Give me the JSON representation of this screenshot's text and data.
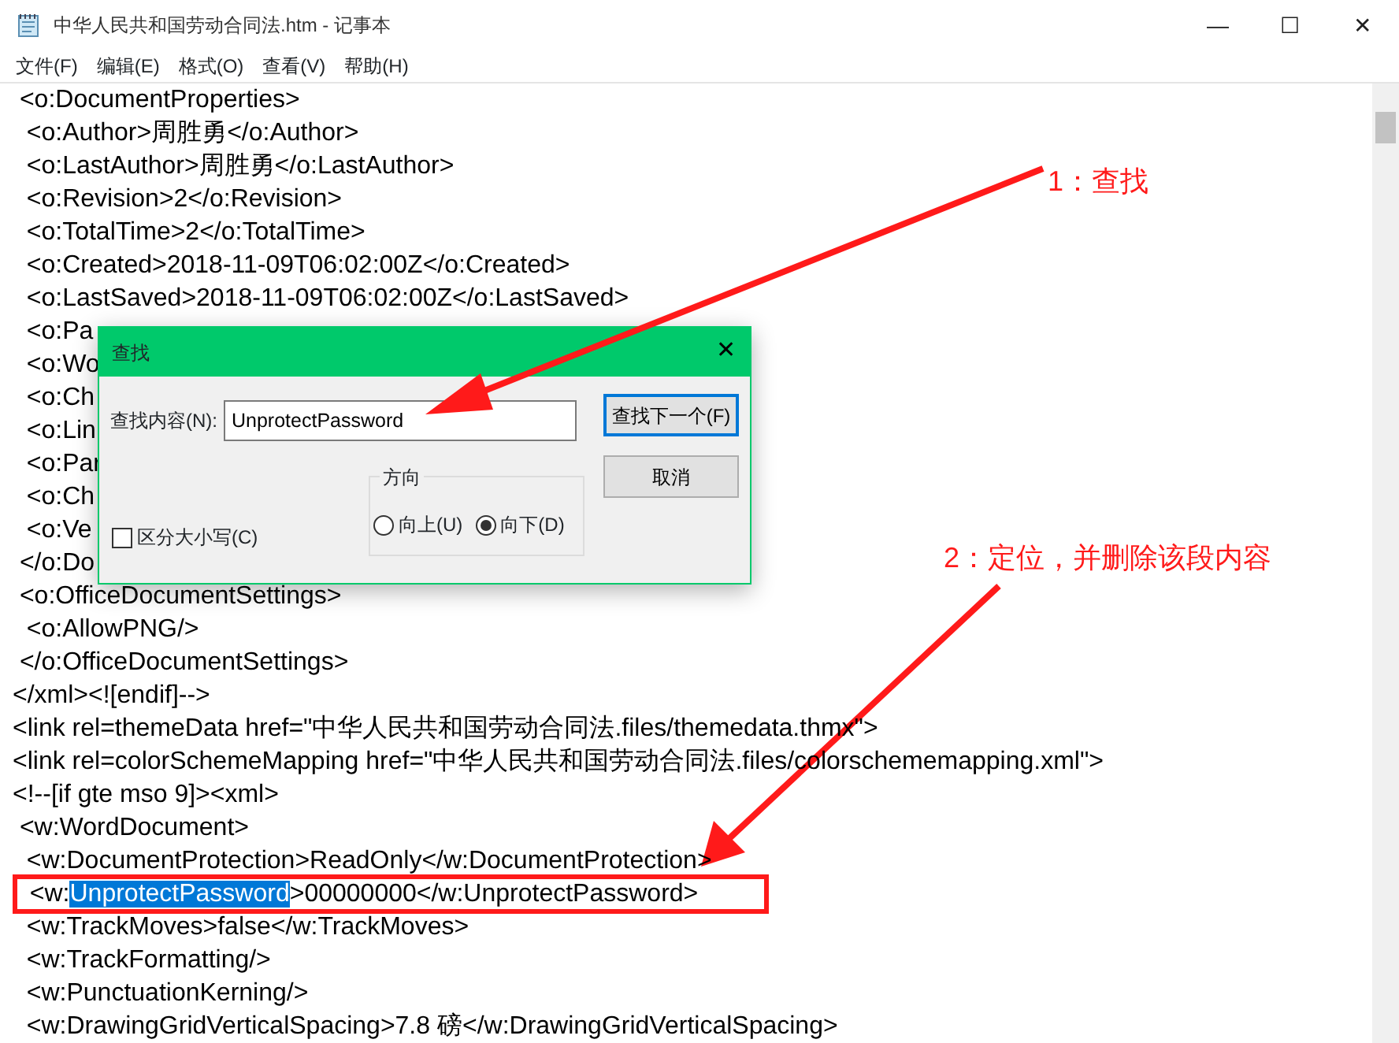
{
  "window": {
    "title": "中华人民共和国劳动合同法.htm - 记事本",
    "controls": [
      "—",
      "☐",
      "✕"
    ]
  },
  "menu": [
    "文件(F)",
    "编辑(E)",
    "格式(O)",
    "查看(V)",
    "帮助(H)"
  ],
  "lines": [
    {
      "text": " <o:DocumentProperties>"
    },
    {
      "text": "  <o:Author>周胜勇</o:Author>"
    },
    {
      "text": "  <o:LastAuthor>周胜勇</o:LastAuthor>"
    },
    {
      "text": "  <o:Revision>2</o:Revision>"
    },
    {
      "text": "  <o:TotalTime>2</o:TotalTime>"
    },
    {
      "text": "  <o:Created>2018-11-09T06:02:00Z</o:Created>"
    },
    {
      "text": "  <o:LastSaved>2018-11-09T06:02:00Z</o:LastSaved>"
    },
    {
      "text": "  <o:Pa"
    },
    {
      "text": "  <o:Wo"
    },
    {
      "text": "  <o:Ch"
    },
    {
      "text": "  <o:Lin"
    },
    {
      "text": "  <o:Par"
    },
    {
      "text": "  <o:Ch"
    },
    {
      "text": "  <o:Ve"
    },
    {
      "text": " </o:Do"
    },
    {
      "text": " <o:OfficeDocumentSettings>"
    },
    {
      "text": "  <o:AllowPNG/>"
    },
    {
      "text": " </o:OfficeDocumentSettings>"
    },
    {
      "text": "</xml><![endif]-->"
    },
    {
      "text": "<link rel=themeData href=\"中华人民共和国劳动合同法.files/themedata.thmx\">"
    },
    {
      "text": "<link rel=colorSchemeMapping href=\"中华人民共和国劳动合同法.files/colorschememapping.xml\">"
    },
    {
      "text": "<!--[if gte mso 9]><xml>"
    },
    {
      "text": " <w:WordDocument>"
    },
    {
      "text": "  <w:DocumentProtection>ReadOnly</w:DocumentProtection>"
    },
    {
      "boxed": true,
      "parts": [
        {
          "text": "  <w:",
          "selected": false
        },
        {
          "text": "UnprotectPassword",
          "selected": true
        },
        {
          "text": ">00000000</w:UnprotectPassword>",
          "selected": false
        }
      ]
    },
    {
      "text": "  <w:TrackMoves>false</w:TrackMoves>"
    },
    {
      "text": "  <w:TrackFormatting/>"
    },
    {
      "text": "  <w:PunctuationKerning/>"
    },
    {
      "text": "  <w:DrawingGridVerticalSpacing>7.8 磅</w:DrawingGridVerticalSpacing>"
    }
  ],
  "find_dialog": {
    "title": "查找",
    "close": "✕",
    "find_label": "查找内容(N):",
    "find_value": "UnprotectPassword",
    "buttons": [
      {
        "label": "查找下一个(F)",
        "default": true
      },
      {
        "label": "取消",
        "default": false
      }
    ],
    "match_case": {
      "label": "区分大小写(C)",
      "checked": false
    },
    "direction": {
      "label": "方向",
      "options": [
        {
          "label": "向上(U)",
          "selected": false
        },
        {
          "label": "向下(D)",
          "selected": true
        }
      ]
    }
  },
  "annotations": [
    "1：查找",
    "2：定位，并删除该段内容"
  ]
}
